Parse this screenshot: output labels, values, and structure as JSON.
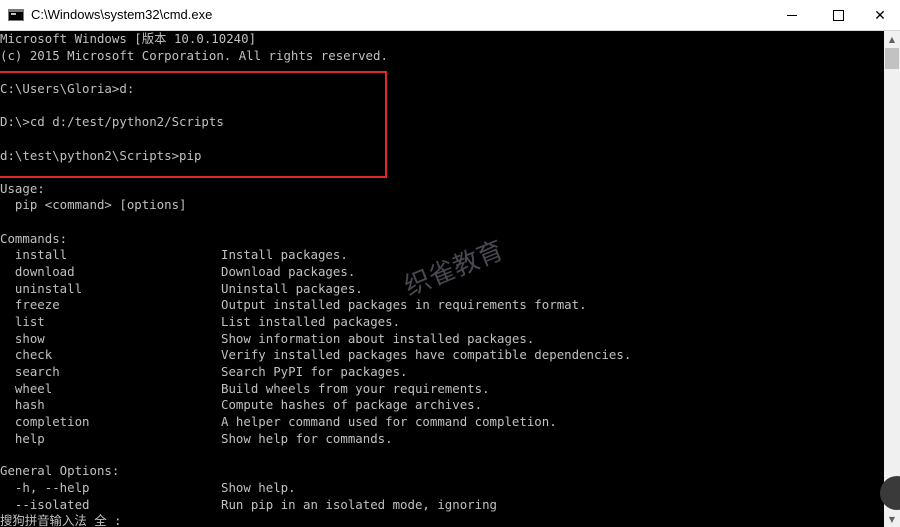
{
  "window": {
    "title": "C:\\Windows\\system32\\cmd.exe"
  },
  "controls": {
    "minimize": "—",
    "maximize": "☐",
    "close": "✕"
  },
  "console": {
    "lines": [
      "Microsoft Windows [版本 10.0.10240]",
      "(c) 2015 Microsoft Corporation. All rights reserved.",
      "",
      "C:\\Users\\Gloria>d:",
      "",
      "D:\\>cd d:/test/python2/Scripts",
      "",
      "d:\\test\\python2\\Scripts>pip",
      "",
      "Usage:",
      "  pip <command> [options]",
      "",
      "Commands:"
    ],
    "commands": [
      {
        "name": "  install",
        "desc": "Install packages."
      },
      {
        "name": "  download",
        "desc": "Download packages."
      },
      {
        "name": "  uninstall",
        "desc": "Uninstall packages."
      },
      {
        "name": "  freeze",
        "desc": "Output installed packages in requirements format."
      },
      {
        "name": "  list",
        "desc": "List installed packages."
      },
      {
        "name": "  show",
        "desc": "Show information about installed packages."
      },
      {
        "name": "  check",
        "desc": "Verify installed packages have compatible dependencies."
      },
      {
        "name": "  search",
        "desc": "Search PyPI for packages."
      },
      {
        "name": "  wheel",
        "desc": "Build wheels from your requirements."
      },
      {
        "name": "  hash",
        "desc": "Compute hashes of package archives."
      },
      {
        "name": "  completion",
        "desc": "A helper command used for command completion."
      },
      {
        "name": "  help",
        "desc": "Show help for commands."
      }
    ],
    "general_header": "General Options:",
    "options": [
      {
        "name": "  -h, --help",
        "desc": "Show help."
      },
      {
        "name": "  --isolated",
        "desc": "Run pip in an isolated mode, ignoring"
      }
    ],
    "ime_status": "搜狗拼音输入法 全 :"
  },
  "watermark": "织雀教育"
}
